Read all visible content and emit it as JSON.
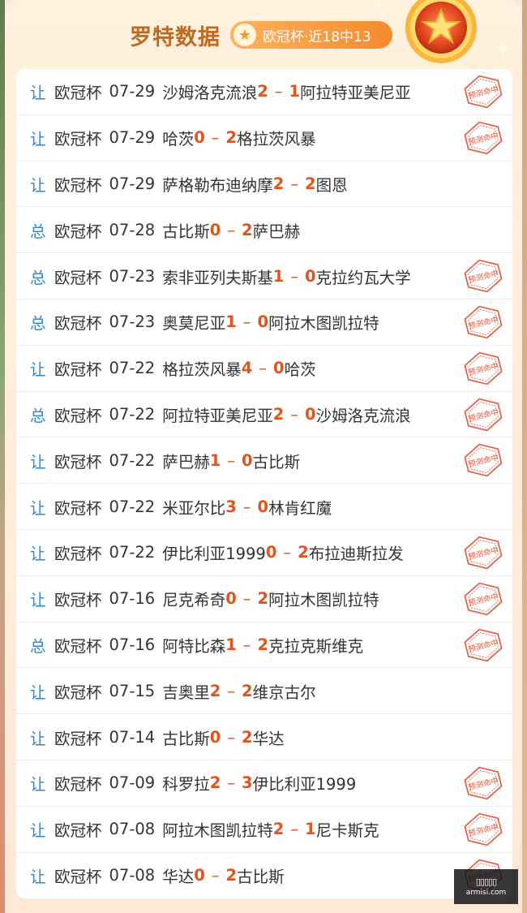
{
  "header": {
    "title": "罗特数据",
    "badge_text": "欧冠杯·近18中13"
  },
  "stamp_text": "预测命中",
  "matches": [
    {
      "type": "让",
      "league": "欧冠杯",
      "date": "07-29",
      "home": "沙姆洛克流浪",
      "home_score": "2",
      "away_score": "1",
      "away": "阿拉特亚美尼亚",
      "hit": true
    },
    {
      "type": "让",
      "league": "欧冠杯",
      "date": "07-29",
      "home": "哈茨",
      "home_score": "0",
      "away_score": "2",
      "away": "格拉茨风暴",
      "hit": true
    },
    {
      "type": "让",
      "league": "欧冠杯",
      "date": "07-29",
      "home": "萨格勒布迪纳摩",
      "home_score": "2",
      "away_score": "2",
      "away": "图恩",
      "hit": false
    },
    {
      "type": "总",
      "league": "欧冠杯",
      "date": "07-28",
      "home": "古比斯",
      "home_score": "0",
      "away_score": "2",
      "away": "萨巴赫",
      "hit": false
    },
    {
      "type": "总",
      "league": "欧冠杯",
      "date": "07-23",
      "home": "索非亚列夫斯基",
      "home_score": "1",
      "away_score": "0",
      "away": "克拉约瓦大学",
      "hit": true
    },
    {
      "type": "总",
      "league": "欧冠杯",
      "date": "07-23",
      "home": "奥莫尼亚",
      "home_score": "1",
      "away_score": "0",
      "away": "阿拉木图凯拉特",
      "hit": true
    },
    {
      "type": "让",
      "league": "欧冠杯",
      "date": "07-22",
      "home": "格拉茨风暴",
      "home_score": "4",
      "away_score": "0",
      "away": "哈茨",
      "hit": true
    },
    {
      "type": "总",
      "league": "欧冠杯",
      "date": "07-22",
      "home": "阿拉特亚美尼亚",
      "home_score": "2",
      "away_score": "0",
      "away": "沙姆洛克流浪",
      "hit": true
    },
    {
      "type": "让",
      "league": "欧冠杯",
      "date": "07-22",
      "home": "萨巴赫",
      "home_score": "1",
      "away_score": "0",
      "away": "古比斯",
      "hit": true
    },
    {
      "type": "让",
      "league": "欧冠杯",
      "date": "07-22",
      "home": "米亚尔比",
      "home_score": "3",
      "away_score": "0",
      "away": "林肯红魔",
      "hit": false
    },
    {
      "type": "让",
      "league": "欧冠杯",
      "date": "07-22",
      "home": "伊比利亚1999",
      "home_score": "0",
      "away_score": "2",
      "away": "布拉迪斯拉发",
      "hit": true
    },
    {
      "type": "让",
      "league": "欧冠杯",
      "date": "07-16",
      "home": "尼克希奇",
      "home_score": "0",
      "away_score": "2",
      "away": "阿拉木图凯拉特",
      "hit": true
    },
    {
      "type": "总",
      "league": "欧冠杯",
      "date": "07-16",
      "home": "阿特比森",
      "home_score": "1",
      "away_score": "2",
      "away": "克拉克斯维克",
      "hit": true
    },
    {
      "type": "让",
      "league": "欧冠杯",
      "date": "07-15",
      "home": "吉奥里",
      "home_score": "2",
      "away_score": "2",
      "away": "维京古尔",
      "hit": false
    },
    {
      "type": "让",
      "league": "欧冠杯",
      "date": "07-14",
      "home": "古比斯",
      "home_score": "0",
      "away_score": "2",
      "away": "华达",
      "hit": false
    },
    {
      "type": "让",
      "league": "欧冠杯",
      "date": "07-09",
      "home": "科罗拉",
      "home_score": "2",
      "away_score": "3",
      "away": "伊比利亚1999",
      "hit": true
    },
    {
      "type": "让",
      "league": "欧冠杯",
      "date": "07-08",
      "home": "阿拉木图凯拉特",
      "home_score": "2",
      "away_score": "1",
      "away": "尼卡斯克",
      "hit": true
    },
    {
      "type": "让",
      "league": "欧冠杯",
      "date": "07-08",
      "home": "华达",
      "home_score": "0",
      "away_score": "2",
      "away": "古比斯",
      "hit": true
    }
  ],
  "watermark": {
    "logo": "▯▯▯▯▯",
    "text": "armisi.com"
  },
  "colors": {
    "title": "#bf6a22",
    "type_label": "#2a86d8",
    "score": "#e2541b",
    "stamp": "#e4573a",
    "badge": "#f48a2e"
  }
}
